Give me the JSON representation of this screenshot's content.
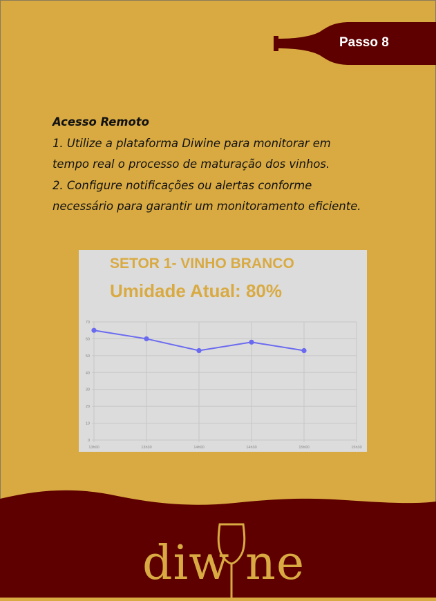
{
  "step": {
    "label": "Passo 8"
  },
  "instructions": {
    "heading": "Acesso Remoto",
    "lines": [
      "1. Utilize a plataforma Diwine para monitorar em",
      "tempo real o processo de maturação dos vinhos.",
      "2. Configure notificações ou alertas conforme",
      "necessário para garantir um monitoramento eficiente."
    ]
  },
  "chart_card": {
    "title": "SETOR 1- VINHO BRANCO",
    "subtitle": "Umidade Atual: 80%"
  },
  "chart_data": {
    "type": "line",
    "x": [
      "13h00",
      "13h30",
      "14h00",
      "14h30",
      "15h00",
      "15h30"
    ],
    "series": [
      {
        "values": [
          65,
          60,
          53,
          58,
          53
        ]
      }
    ],
    "yticks": [
      "0",
      "10",
      "20",
      "30",
      "40",
      "50",
      "60",
      "70"
    ],
    "ylim": [
      0,
      70
    ],
    "grid": true,
    "line_color": "#6a6af0"
  },
  "colors": {
    "background": "#d9aa42",
    "wine": "#5e0000",
    "accent": "#d9aa42"
  },
  "footer": {
    "logo_text": "diw ne",
    "logo_icon": "wine-glass-icon"
  }
}
